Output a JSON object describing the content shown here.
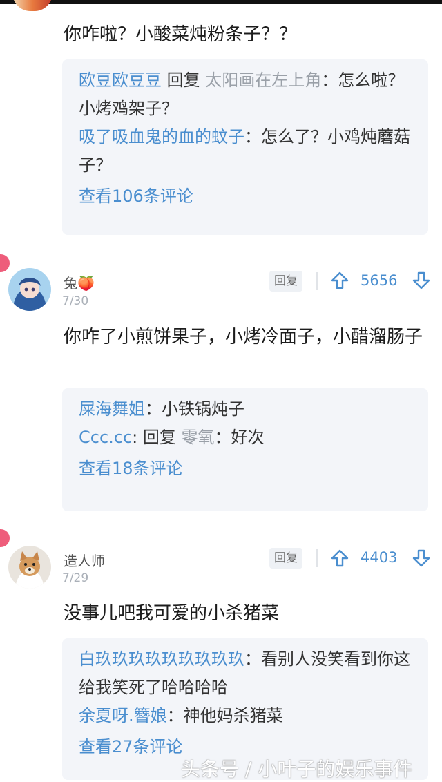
{
  "comments": [
    {
      "text": "你咋啦？小酸菜炖粉条子？？",
      "replies": [
        {
          "name": "欧豆欧豆豆",
          "sep": " 回复 ",
          "target": "太阳画在左上角",
          "body": "：怎么啦？小烤鸡架子？"
        },
        {
          "name": "吸了吸血鬼的血的蚊子",
          "body": "：怎么了？小鸡炖蘑菇子？"
        }
      ],
      "view_more": "查看106条评论"
    },
    {
      "user": "兔🍑",
      "date": "7/30",
      "reply_label": "回复",
      "votes": "5656",
      "text": "你咋了小煎饼果子，小烤冷面子，小醋溜肠子",
      "replies": [
        {
          "name": "屎海舞姐",
          "body": "：小铁锅炖子"
        },
        {
          "name": "Ccc.cc",
          "sep": ": 回复 ",
          "target": "零氧",
          "body": "：好次"
        }
      ],
      "view_more": "查看18条评论"
    },
    {
      "user": "造人师",
      "date": "7/29",
      "reply_label": "回复",
      "votes": "4403",
      "text": "没事儿吧我可爱的小杀猪菜",
      "replies": [
        {
          "name": "白玖玖玖玖玖玖玖玖玖",
          "body": "：看别人没笑看到你这给我笑死了哈哈哈哈"
        },
        {
          "name": "余夏呀.簪娘",
          "body": "：神他妈杀猪菜"
        }
      ],
      "view_more": "查看27条评论"
    }
  ],
  "watermark": "头条号 / 小叶子的娱乐事件",
  "colors": {
    "link": "#4a8ecf",
    "reply_bg": "#f3f5f9",
    "hot_tag": "#ee5d7b"
  },
  "icons": [
    "thumb-up-arrow-icon",
    "thumb-down-arrow-icon"
  ]
}
